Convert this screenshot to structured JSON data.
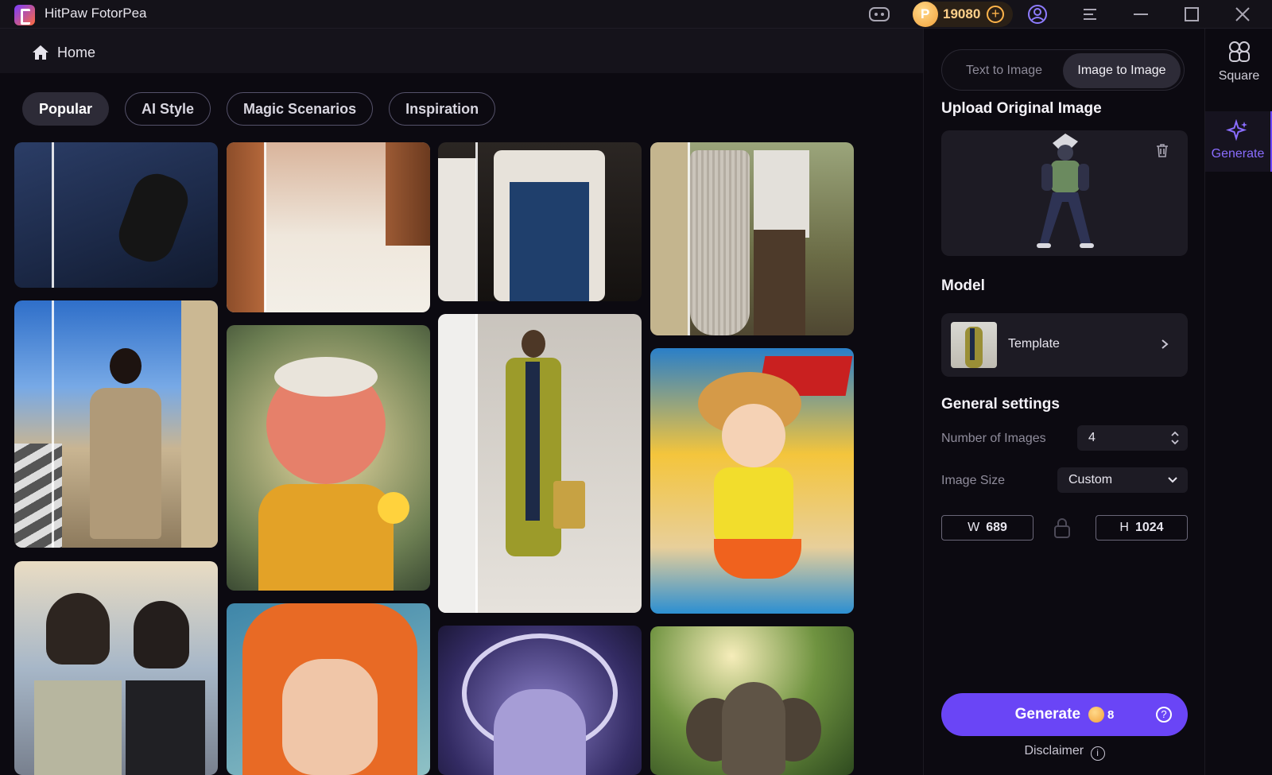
{
  "titlebar": {
    "app_name": "HitPaw FotorPea",
    "credits": "19080"
  },
  "home": {
    "label": "Home"
  },
  "chips": [
    {
      "label": "Popular",
      "active": true
    },
    {
      "label": "AI Style",
      "active": false
    },
    {
      "label": "Magic Scenarios",
      "active": false
    },
    {
      "label": "Inspiration",
      "active": false
    }
  ],
  "panel": {
    "tabs": {
      "text_to_image": "Text to Image",
      "image_to_image": "Image to Image"
    },
    "upload_title": "Upload Original Image",
    "model_title": "Model",
    "model_name": "Template",
    "general_title": "General settings",
    "num_images_label": "Number of Images",
    "num_images_value": "4",
    "image_size_label": "Image Size",
    "image_size_value": "Custom",
    "width_label": "W",
    "width_value": "689",
    "height_label": "H",
    "height_value": "1024",
    "generate_label": "Generate",
    "generate_cost": "8",
    "disclaimer": "Disclaimer"
  },
  "sidenav": {
    "square": "Square",
    "generate": "Generate"
  },
  "colors": {
    "accent": "#6a45f6",
    "coin": "#f2a13a",
    "background": "#0c0a11"
  }
}
